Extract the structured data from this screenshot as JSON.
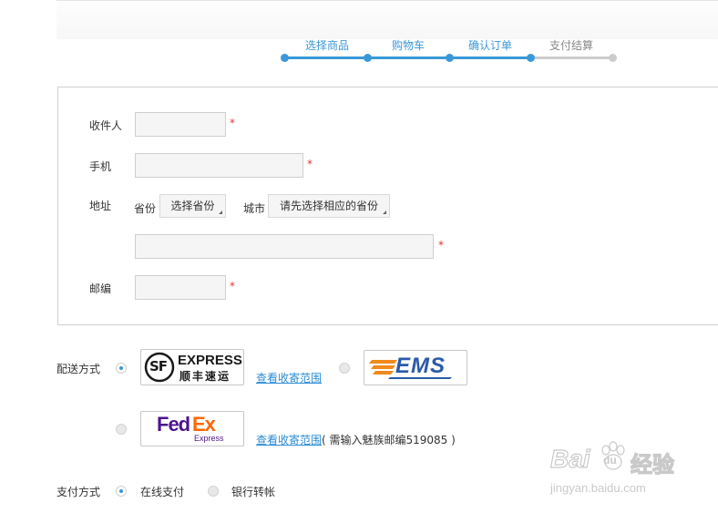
{
  "steps": [
    {
      "label": "选择商品",
      "state": "done"
    },
    {
      "label": "购物车",
      "state": "done"
    },
    {
      "label": "确认订单",
      "state": "current"
    },
    {
      "label": "支付结算",
      "state": "todo"
    }
  ],
  "colors": {
    "accent": "#3a98d8",
    "inactive": "#cccccc",
    "required": "#e0353b",
    "link": "#2b8cd4"
  },
  "form": {
    "receiver_label": "收件人",
    "phone_label": "手机",
    "address_label": "地址",
    "province_label": "省份",
    "province_select": "选择省份",
    "city_label": "城市",
    "city_select": "请先选择相应的省份",
    "zip_label": "邮编",
    "required_mark": "*"
  },
  "shipping": {
    "label": "配送方式",
    "options": [
      {
        "carrier": "SF EXPRESS",
        "logo_text_main": "EXPRESS",
        "logo_text_cn": "顺丰速运",
        "logo_badge": "SF",
        "selected": true,
        "link": "查看收寄范围"
      },
      {
        "carrier": "EMS",
        "logo_text_main": "EMS",
        "selected": false
      },
      {
        "carrier": "FedEx",
        "logo_text_fed": "Fed",
        "logo_text_ex": "Ex",
        "logo_text_sub": "Express",
        "selected": false,
        "link": "查看收寄范围",
        "note": "( 需输入魅族邮编519085 )"
      }
    ]
  },
  "payment": {
    "label": "支付方式",
    "options": [
      {
        "label": "在线支付",
        "selected": true
      },
      {
        "label": "银行转帐",
        "selected": false
      }
    ]
  },
  "watermark": {
    "brand_a": "Bai",
    "brand_b": "du",
    "brand_cn": "经验",
    "url": "jingyan.baidu.com"
  }
}
